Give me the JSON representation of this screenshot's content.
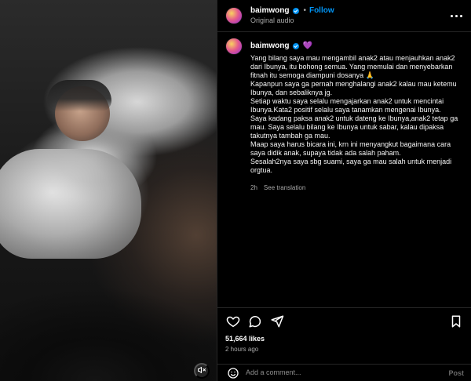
{
  "colors": {
    "accent": "#0095f6",
    "text": "#f5f5f5",
    "muted": "#a8a8a8",
    "divider": "#262626",
    "background": "#000000"
  },
  "header": {
    "username": "baimwong",
    "follow_label": "Follow",
    "dot": "•",
    "audio_label": "Original audio",
    "icons": {
      "verified": "verified-badge-icon",
      "more": "more-options-icon"
    }
  },
  "caption": {
    "username": "baimwong",
    "heart_emoji": "💜",
    "text": "Yang bilang saya mau mengambil anak2 atau menjauhkan anak2 dari Ibunya, itu bohong semua. Yang memulai dan menyebarkan fitnah itu semoga diampuni dosanya 🙏\nKapanpun saya ga pernah menghalangi anak2 kalau mau ketemu Ibunya, dan sebaliknya jg.\nSetiap waktu saya selalu mengajarkan anak2 untuk mencintai Ibunya.Kata2 positif selalu saya tanamkan mengenai Ibunya.\nSaya kadang paksa anak2 untuk dateng ke Ibunya,anak2 tetap ga mau. Saya selalu bilang ke Ibunya untuk sabar, kalau dipaksa takutnya tambah ga mau.\nMaap saya harus bicara ini, krn ini menyangkut bagaimana cara saya didik anak, supaya tidak ada salah paham.\nSesalah2nya saya sbg suami, saya ga mau salah untuk menjadi orgtua.",
    "time_ago": "2h",
    "see_translation": "See translation"
  },
  "actions": {
    "icons": [
      "heart-icon",
      "comment-icon",
      "share-icon",
      "save-icon"
    ]
  },
  "stats": {
    "likes": "51,664 likes",
    "timestamp": "2 hours ago"
  },
  "comment": {
    "placeholder": "Add a comment...",
    "post_label": "Post",
    "icons": {
      "emoji": "emoji-icon"
    }
  },
  "media": {
    "icons": {
      "mute": "mute-icon"
    }
  }
}
